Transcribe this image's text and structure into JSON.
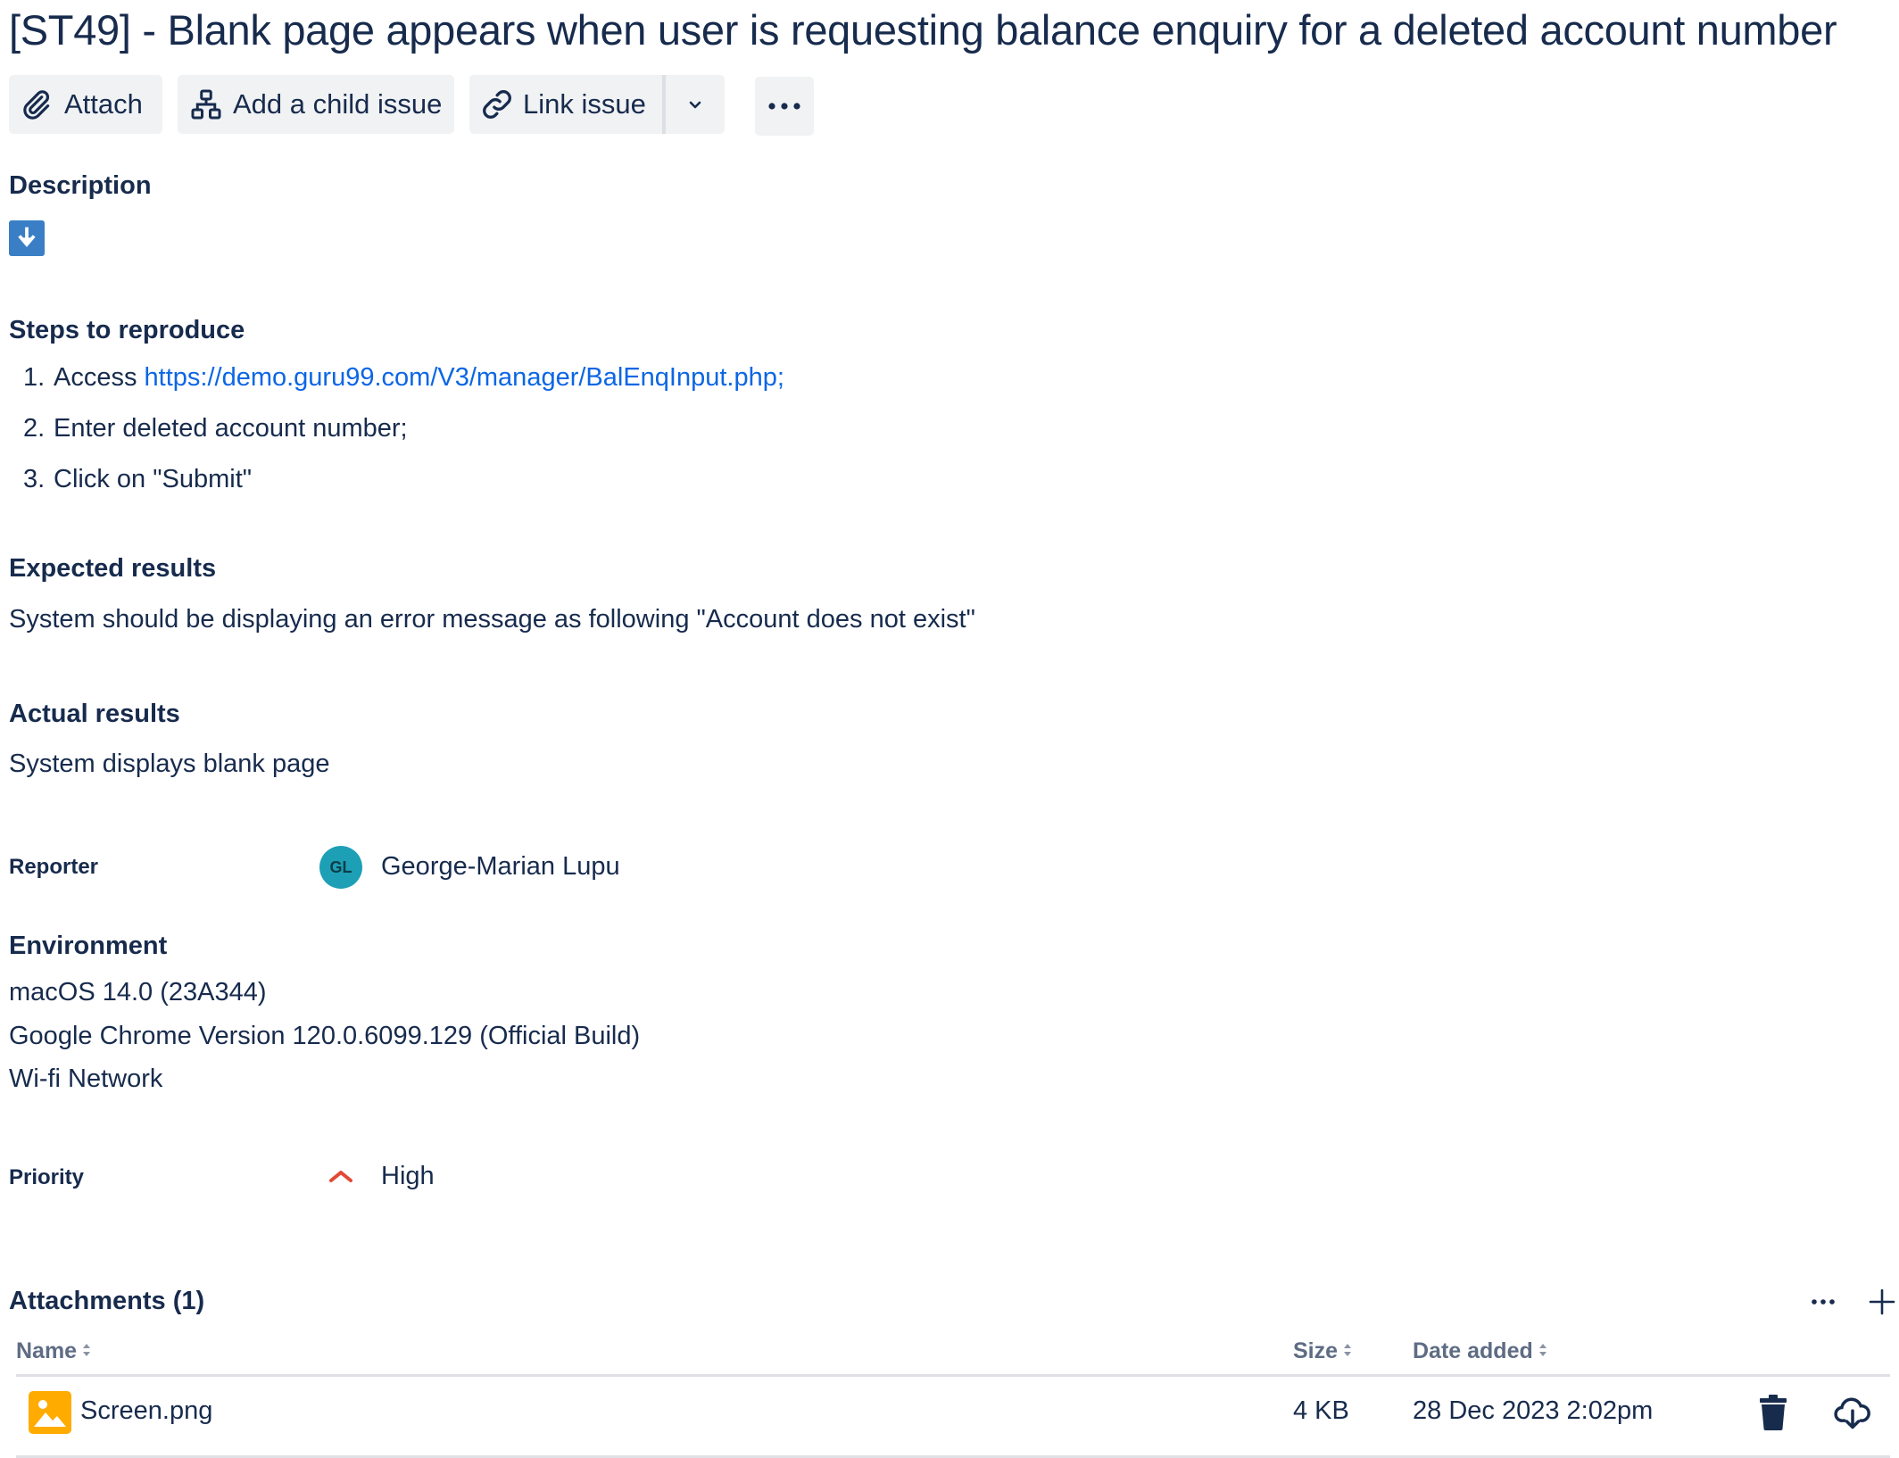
{
  "issue": {
    "title": "[ST49] - Blank page appears when user is requesting balance enquiry for a deleted account number"
  },
  "toolbar": {
    "attach_label": "Attach",
    "add_child_label": "Add a child issue",
    "link_issue_label": "Link issue"
  },
  "description": {
    "heading": "Description",
    "steps_heading": "Steps to reproduce",
    "steps": [
      {
        "num": "1.",
        "text": "Access ",
        "link": "https://demo.guru99.com/V3/manager/BalEnqInput.php;"
      },
      {
        "num": "2.",
        "text": "Enter deleted account number;"
      },
      {
        "num": "3.",
        "text": "Click on \"Submit\""
      }
    ],
    "expected_heading": "Expected results",
    "expected_text": "System should be displaying an error message as following \"Account does not exist\"",
    "actual_heading": "Actual results",
    "actual_text": "System displays blank page"
  },
  "reporter": {
    "label": "Reporter",
    "initials": "GL",
    "name": "George-Marian Lupu",
    "avatar_color": "#1d9fb6"
  },
  "environment": {
    "heading": "Environment",
    "lines": [
      "macOS 14.0 (23A344)",
      "Google Chrome Version 120.0.6099.129 (Official Build)",
      "Wi-fi Network"
    ]
  },
  "priority": {
    "label": "Priority",
    "value": "High",
    "icon": "priority-high-icon",
    "color": "#e34935"
  },
  "attachments": {
    "heading": "Attachments (1)",
    "columns": {
      "name": "Name",
      "size": "Size",
      "date": "Date added"
    },
    "items": [
      {
        "name": "Screen.png",
        "size": "4 KB",
        "date": "28 Dec 2023 2:02pm",
        "icon": "image-file-icon"
      }
    ]
  },
  "colors": {
    "text": "#172b4d",
    "link": "#0c66e4",
    "button_bg": "#f1f2f4",
    "description_toggle": "#3a7fc6",
    "file_thumb": "#ffab00"
  }
}
